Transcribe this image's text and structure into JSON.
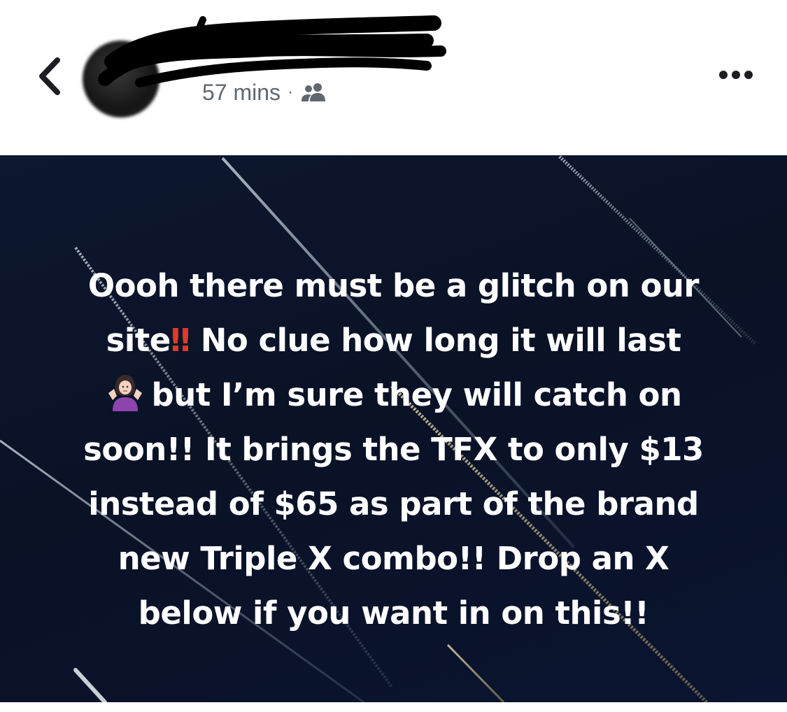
{
  "header": {
    "timestamp": "57 mins",
    "separator": "·",
    "back_icon": "chevron-left-icon",
    "audience_icon": "friends-icon",
    "more_icon": "ellipsis-icon"
  },
  "post": {
    "background_color": "#0b1430",
    "text_color": "#ffffff",
    "line1": "Oooh there must be a glitch on our",
    "line2_a": "site",
    "line2_emoji": "‼",
    "line2_b": " No clue how long it will last",
    "line3_emoji": "person-shrugging-emoji",
    "line3": "but I’m sure they will catch on",
    "line4": "soon!! It brings the TFX to only $13",
    "line5": "instead of $65 as part of the brand",
    "line6": "new Triple X combo!! Drop an X",
    "line7": "below if you want in on this!!"
  }
}
